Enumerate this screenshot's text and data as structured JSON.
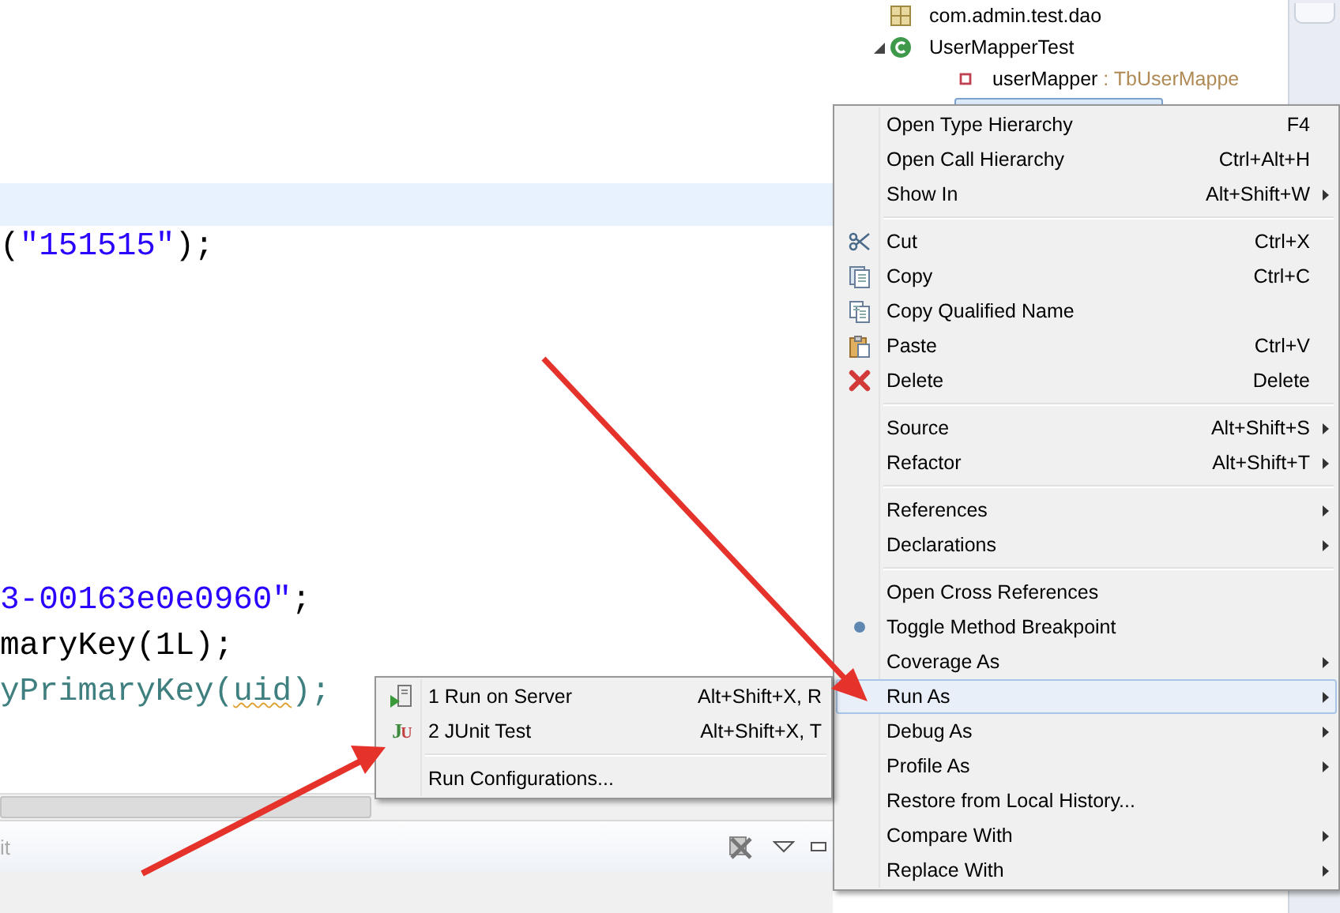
{
  "editor": {
    "lines": [
      {
        "current": true
      },
      {
        "current": false,
        "parts": [
          {
            "text": "(",
            "kind": "plain"
          },
          {
            "text": "\"151515\"",
            "kind": "string"
          },
          {
            "text": ");",
            "kind": "plain"
          }
        ]
      },
      {
        "current": false,
        "parts": [
          {
            "text": "3-00163e0e0960\"",
            "kind": "string"
          },
          {
            "text": ";",
            "kind": "plain"
          }
        ]
      },
      {
        "current": false,
        "parts": [
          {
            "text": "maryKey(1L);",
            "kind": "plain"
          }
        ]
      },
      {
        "current": false,
        "parts": [
          {
            "text": "yPrimaryKey(",
            "kind": "method"
          },
          {
            "text": "uid",
            "kind": "warning"
          },
          {
            "text": ");",
            "kind": "method"
          }
        ]
      }
    ]
  },
  "bottom_panel": {
    "tab_label": "it"
  },
  "tree": [
    {
      "label": "com.admin.test.dao",
      "kind": "package"
    },
    {
      "label": "UserMapperTest",
      "kind": "class",
      "expanded": true,
      "children": [
        {
          "label": "userMapper",
          "type": " : TbUserMappe",
          "kind": "field"
        }
      ]
    }
  ],
  "context_menu": {
    "groups": [
      [
        {
          "label": "Open Type Hierarchy",
          "shortcut": "F4",
          "submenu": false,
          "selected": false
        },
        {
          "label": "Open Call Hierarchy",
          "shortcut": "Ctrl+Alt+H",
          "submenu": false,
          "selected": false
        },
        {
          "label": "Show In",
          "shortcut": "Alt+Shift+W",
          "submenu": true,
          "selected": false
        }
      ],
      [
        {
          "label": "Cut",
          "shortcut": "Ctrl+X",
          "submenu": false,
          "selected": false
        },
        {
          "label": "Copy",
          "shortcut": "Ctrl+C",
          "submenu": false,
          "selected": false
        },
        {
          "label": "Copy Qualified Name",
          "submenu": false,
          "selected": false
        },
        {
          "label": "Paste",
          "shortcut": "Ctrl+V",
          "submenu": false,
          "selected": false
        },
        {
          "label": "Delete",
          "shortcut": "Delete",
          "submenu": false,
          "selected": false
        }
      ],
      [
        {
          "label": "Source",
          "shortcut": "Alt+Shift+S",
          "submenu": true,
          "selected": false
        },
        {
          "label": "Refactor",
          "shortcut": "Alt+Shift+T",
          "submenu": true,
          "selected": false
        }
      ],
      [
        {
          "label": "References",
          "submenu": true,
          "selected": false
        },
        {
          "label": "Declarations",
          "submenu": true,
          "selected": false
        }
      ],
      [
        {
          "label": "Open Cross References",
          "submenu": false,
          "selected": false
        },
        {
          "label": "Toggle Method Breakpoint",
          "submenu": false,
          "selected": false
        },
        {
          "label": "Coverage As",
          "submenu": true,
          "selected": false
        },
        {
          "label": "Run As",
          "submenu": true,
          "selected": true
        },
        {
          "label": "Debug As",
          "submenu": true,
          "selected": false
        },
        {
          "label": "Profile As",
          "submenu": true,
          "selected": false
        },
        {
          "label": "Restore from Local History...",
          "submenu": false,
          "selected": false
        },
        {
          "label": "Compare With",
          "submenu": true,
          "selected": false
        },
        {
          "label": "Replace With",
          "submenu": true,
          "selected": false
        }
      ]
    ]
  },
  "submenu": {
    "groups": [
      [
        {
          "label": "1 Run on Server",
          "shortcut": "Alt+Shift+X, R",
          "selected": false
        },
        {
          "label": "2 JUnit Test",
          "shortcut": "Alt+Shift+X, T",
          "icon": "JU",
          "selected": false
        }
      ],
      [
        {
          "label": "Run Configurations...",
          "selected": false
        }
      ]
    ]
  }
}
